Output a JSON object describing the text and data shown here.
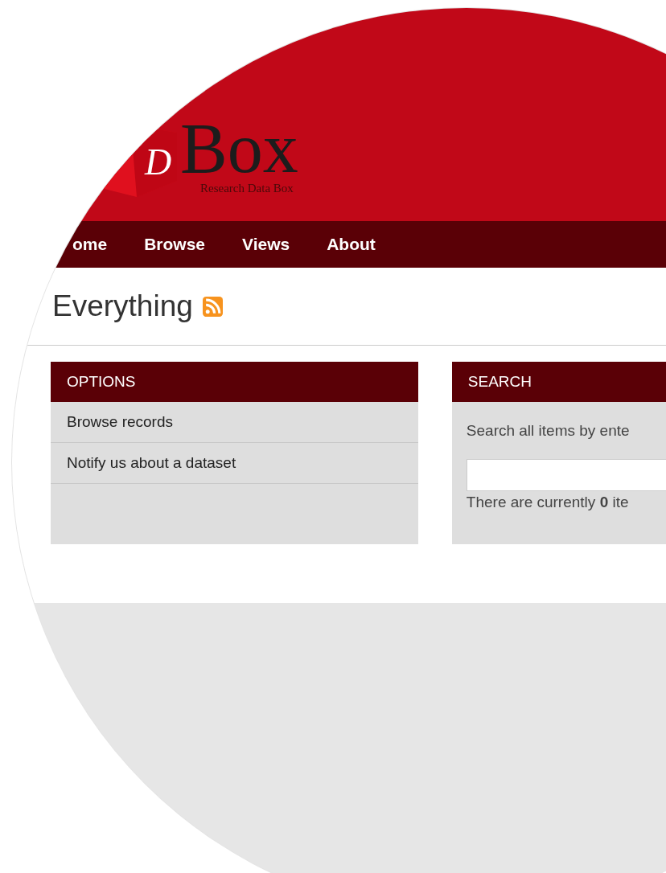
{
  "header": {
    "logo": {
      "letter": "D",
      "wordmark": "Box",
      "tagline": "Research Data Box"
    }
  },
  "nav": [
    {
      "label": "ome"
    },
    {
      "label": "Browse"
    },
    {
      "label": "Views"
    },
    {
      "label": "About"
    }
  ],
  "page": {
    "title": "Everything"
  },
  "options": {
    "title": "OPTIONS",
    "items": [
      "Browse records",
      "Notify us about a dataset"
    ]
  },
  "search": {
    "title": "SEARCH",
    "intro": "Search all items by ente",
    "count_text": "There are currently **0** ite"
  }
}
